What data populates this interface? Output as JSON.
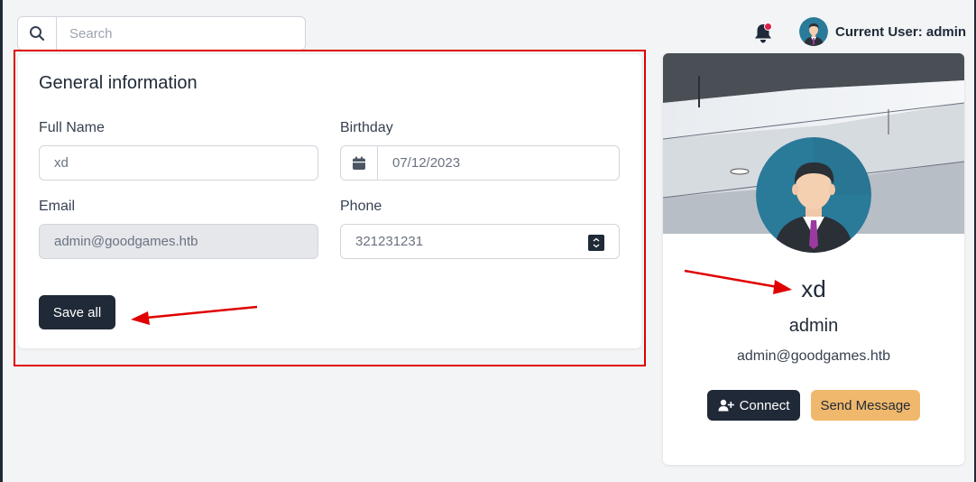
{
  "search": {
    "placeholder": "Search"
  },
  "header": {
    "user_label": "Current User: admin"
  },
  "general": {
    "title": "General information",
    "full_name_label": "Full Name",
    "full_name_value": "xd",
    "birthday_label": "Birthday",
    "birthday_value": "07/12/2023",
    "email_label": "Email",
    "email_value": "admin@goodgames.htb",
    "phone_label": "Phone",
    "phone_value": "321231231",
    "save_label": "Save all"
  },
  "profile": {
    "name": "xd",
    "username": "admin",
    "email": "admin@goodgames.htb",
    "connect_label": "Connect",
    "message_label": "Send Message"
  },
  "colors": {
    "dark": "#1f2937",
    "accent": "#f0b86c",
    "notification": "#e11d48",
    "annotation": "#e00000"
  }
}
